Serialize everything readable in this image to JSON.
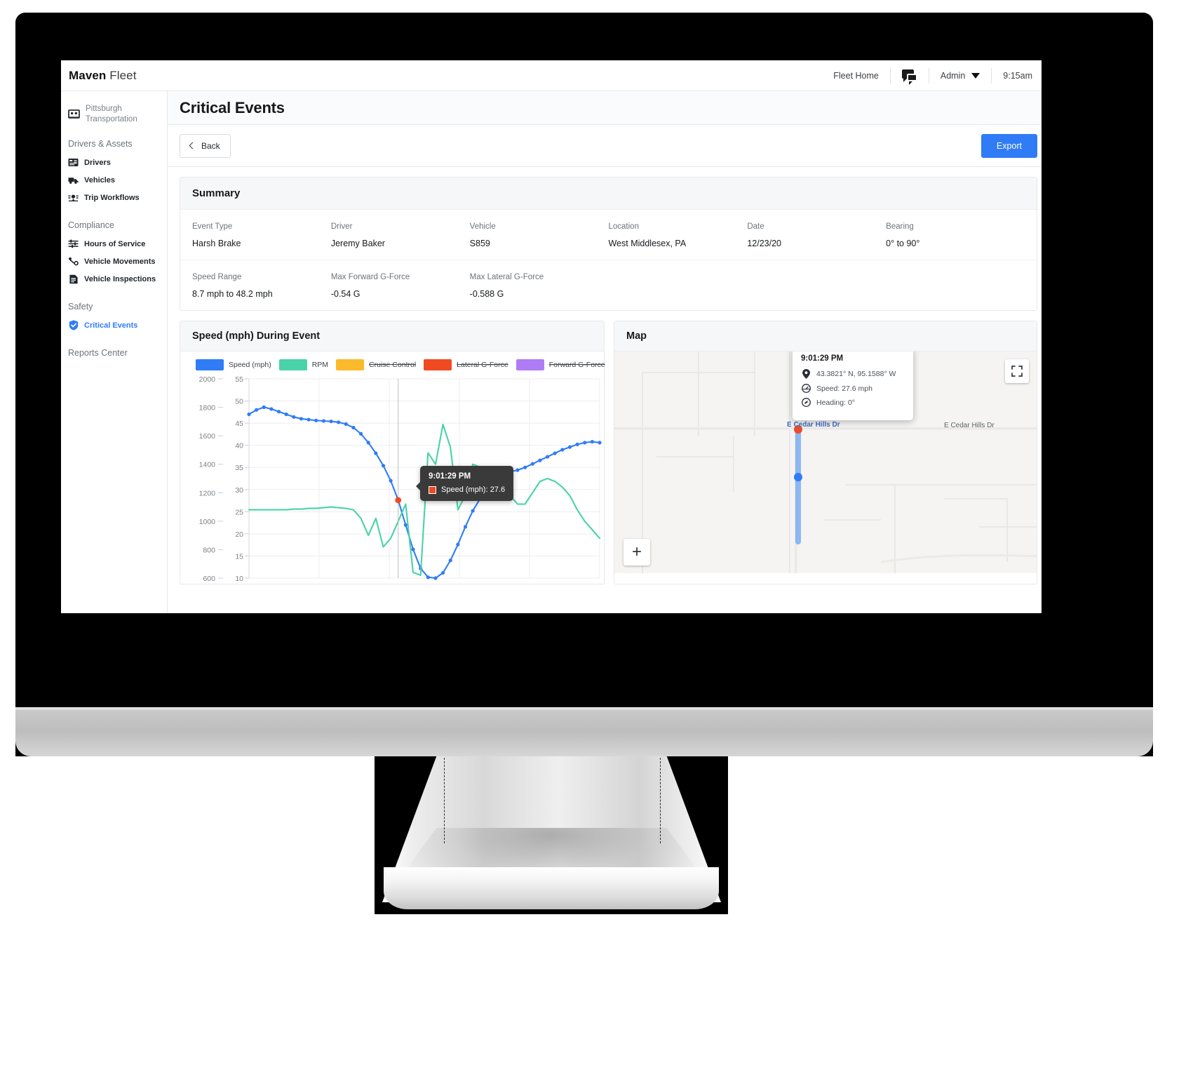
{
  "header": {
    "brand_bold": "Maven",
    "brand_light": "Fleet",
    "fleet_home": "Fleet Home",
    "chat_icon": "chat-bubbles-icon",
    "user": "Admin",
    "time": "9:15am"
  },
  "sidebar": {
    "org_icon": "building-icon",
    "org_name": "Pittsburgh Transportation",
    "groups": [
      {
        "label": "Drivers & Assets",
        "items": [
          {
            "label": "Drivers",
            "icon": "id-card-icon",
            "active": false
          },
          {
            "label": "Vehicles",
            "icon": "truck-icon",
            "active": false
          },
          {
            "label": "Trip Workflows",
            "icon": "route-pin-icon",
            "active": false
          }
        ]
      },
      {
        "label": "Compliance",
        "items": [
          {
            "label": "Hours of Service",
            "icon": "sliders-icon",
            "active": false
          },
          {
            "label": "Vehicle Movements",
            "icon": "movement-icon",
            "active": false
          },
          {
            "label": "Vehicle Inspections",
            "icon": "document-icon",
            "active": false
          }
        ]
      },
      {
        "label": "Safety",
        "items": [
          {
            "label": "Critical Events",
            "icon": "shield-check-icon",
            "active": true
          }
        ]
      }
    ],
    "reports_center": "Reports Center"
  },
  "page": {
    "title": "Critical Events",
    "back_label": "Back",
    "export_label": "Export"
  },
  "summary": {
    "heading": "Summary",
    "row1": [
      {
        "label": "Event Type",
        "value": "Harsh Brake"
      },
      {
        "label": "Driver",
        "value": "Jeremy Baker"
      },
      {
        "label": "Vehicle",
        "value": "S859"
      },
      {
        "label": "Location",
        "value": "West Middlesex, PA"
      },
      {
        "label": "Date",
        "value": "12/23/20"
      },
      {
        "label": "Bearing",
        "value": "0° to 90°"
      }
    ],
    "row2": [
      {
        "label": "Speed Range",
        "value": "8.7 mph to 48.2 mph"
      },
      {
        "label": "Max Forward G-Force",
        "value": "-0.54 G"
      },
      {
        "label": "Max Lateral G-Force",
        "value": "-0.588 G"
      }
    ]
  },
  "speed_panel": {
    "title": "Speed (mph) During Event",
    "tooltip": {
      "time": "9:01:29 PM",
      "series_label": "Speed (mph): 27.6",
      "swatch_color": "#f04a22"
    }
  },
  "map_panel": {
    "title": "Map",
    "fullscreen_icon": "fullscreen-icon",
    "zoom_in_label": "+",
    "road_labels": [
      "E Cedar Hills Dr",
      "E Cedar Hills Dr"
    ],
    "popup": {
      "time": "9:01:29 PM",
      "rows": [
        {
          "icon": "map-pin-icon",
          "text": "43.3821° N, 95.1588° W"
        },
        {
          "icon": "speedometer-icon",
          "text": "Speed: 27.6 mph"
        },
        {
          "icon": "compass-icon",
          "text": "Heading: 0°"
        }
      ]
    }
  },
  "chart_data": {
    "type": "line",
    "title": "Speed (mph) During Event",
    "xlabel": "",
    "ylabel": "Speed (mph)",
    "y2label": "RPM",
    "ylim": [
      10,
      55
    ],
    "y2lim": [
      600,
      2000
    ],
    "yticks": [
      10,
      15,
      20,
      25,
      30,
      35,
      40,
      45,
      50,
      55
    ],
    "y2ticks": [
      600,
      800,
      1000,
      1200,
      1400,
      1600,
      1800,
      2000
    ],
    "grid": true,
    "legend_position": "top",
    "legend": [
      {
        "name": "Speed (mph)",
        "color": "#2f7cf6",
        "enabled": true
      },
      {
        "name": "RPM",
        "color": "#4ad2a8",
        "enabled": true
      },
      {
        "name": "Cruise Control",
        "color": "#fbba2c",
        "enabled": false
      },
      {
        "name": "Lateral G-Force",
        "color": "#f04a22",
        "enabled": false
      },
      {
        "name": "Forward G-Force",
        "color": "#b07cf5",
        "enabled": false
      }
    ],
    "highlight_point": {
      "x_label": "9:01:29 PM",
      "series": "Speed (mph)",
      "value": 27.6,
      "color": "#f04a22"
    },
    "series": [
      {
        "name": "Speed (mph)",
        "color": "#2f7cf6",
        "axis": "left",
        "values": [
          47.0,
          48.0,
          48.6,
          48.2,
          47.6,
          47.0,
          46.4,
          46.0,
          45.8,
          45.6,
          45.5,
          45.4,
          45.2,
          44.8,
          44.0,
          42.6,
          40.6,
          38.2,
          35.4,
          32.0,
          27.6,
          22.0,
          16.5,
          12.2,
          10.2,
          10.0,
          11.2,
          14.0,
          17.6,
          21.6,
          25.2,
          28.0,
          30.4,
          32.2,
          33.4,
          34.0,
          34.4,
          35.0,
          35.8,
          36.6,
          37.4,
          38.2,
          39.0,
          39.6,
          40.2,
          40.6,
          40.8,
          40.6
        ]
      },
      {
        "name": "RPM",
        "color": "#4ad2a8",
        "axis": "right",
        "values": [
          1080,
          1080,
          1080,
          1080,
          1080,
          1080,
          1085,
          1085,
          1090,
          1090,
          1095,
          1100,
          1095,
          1090,
          1080,
          1020,
          900,
          1020,
          820,
          880,
          1000,
          1120,
          640,
          620,
          1480,
          1400,
          1680,
          1520,
          1080,
          1180,
          1400,
          1380,
          1340,
          1300,
          1240,
          1180,
          1120,
          1120,
          1200,
          1280,
          1300,
          1280,
          1240,
          1180,
          1080,
          1000,
          940,
          880
        ]
      }
    ]
  }
}
